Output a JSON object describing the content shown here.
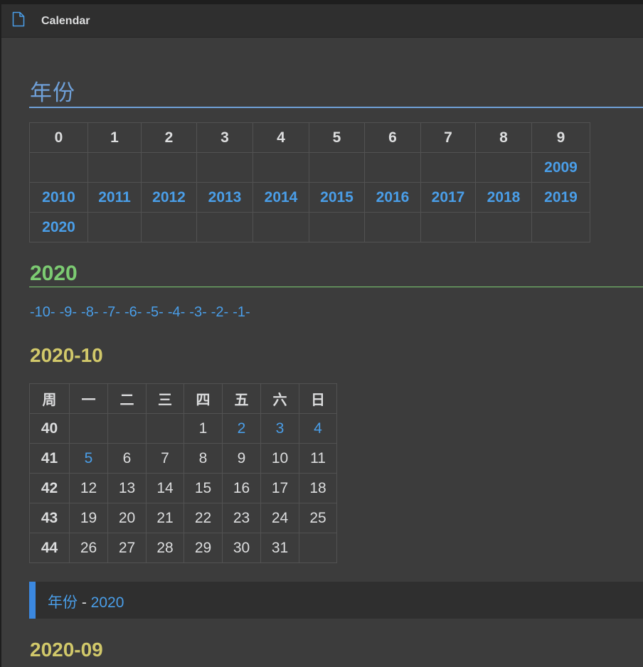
{
  "window": {
    "title": "Calendar",
    "icon": "file-icon"
  },
  "heading_years": "年份",
  "years_table": {
    "headers": [
      "0",
      "1",
      "2",
      "3",
      "4",
      "5",
      "6",
      "7",
      "8",
      "9"
    ],
    "rows": [
      [
        "",
        "",
        "",
        "",
        "",
        "",
        "",
        "",
        "",
        "2009"
      ],
      [
        "2010",
        "2011",
        "2012",
        "2013",
        "2014",
        "2015",
        "2016",
        "2017",
        "2018",
        "2019"
      ],
      [
        "2020",
        "",
        "",
        "",
        "",
        "",
        "",
        "",
        "",
        ""
      ]
    ]
  },
  "heading_year": "2020",
  "month_links": [
    "-10-",
    "-9-",
    "-8-",
    "-7-",
    "-6-",
    "-5-",
    "-4-",
    "-3-",
    "-2-",
    "-1-"
  ],
  "heading_month": "2020-10",
  "calendar": {
    "headers": [
      "周",
      "一",
      "二",
      "三",
      "四",
      "五",
      "六",
      "日"
    ],
    "rows": [
      [
        "40",
        "",
        "",
        "",
        "1",
        "2",
        "3",
        "4"
      ],
      [
        "41",
        "5",
        "6",
        "7",
        "8",
        "9",
        "10",
        "11"
      ],
      [
        "42",
        "12",
        "13",
        "14",
        "15",
        "16",
        "17",
        "18"
      ],
      [
        "43",
        "19",
        "20",
        "21",
        "22",
        "23",
        "24",
        "25"
      ],
      [
        "44",
        "26",
        "27",
        "28",
        "29",
        "30",
        "31",
        ""
      ]
    ],
    "linked_days": [
      "2",
      "3",
      "4",
      "5"
    ]
  },
  "callout": {
    "link1": "年份",
    "separator": " - ",
    "link2": "2020"
  },
  "heading_next_month": "2020-09",
  "colors": {
    "background": "#3c3c3c",
    "titlebar": "#2f2f2f",
    "link": "#4a9ee8",
    "h1": "#6fa0d8",
    "h2": "#7ccb72",
    "h3": "#d1c86a",
    "callout_bar": "#3b88e0"
  }
}
